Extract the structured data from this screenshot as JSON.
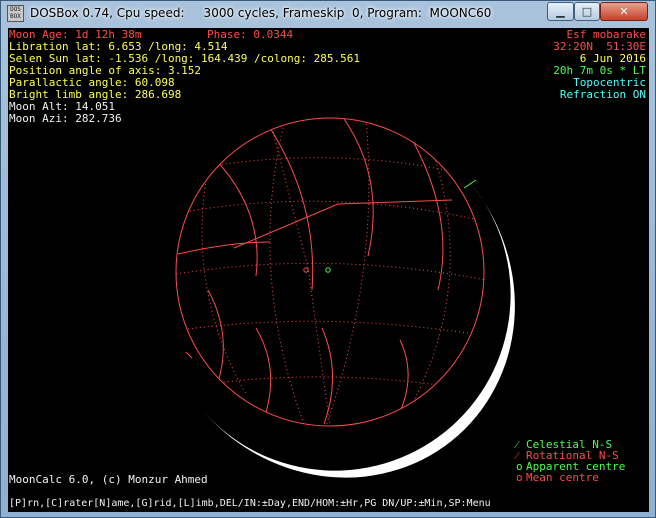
{
  "window": {
    "icon_top": "DOS",
    "icon_bottom": "BOX",
    "title": "DOSBox 0.74, Cpu speed:     3000 cycles, Frameskip  0, Program:  MOONC60",
    "minimize_glyph": "▁",
    "maximize_glyph": "□",
    "close_glyph": "✕"
  },
  "info_left": {
    "moon_age": "Moon Age: 1d 12h 38m",
    "phase": "Phase: 0.0344",
    "libration": "Libration lat: 6.653 /long: 4.514",
    "selen_sun": "Selen Sun lat: -1.536 /long: 164.439 /colong: 285.561",
    "position_angle": "Position angle of axis: 3.152",
    "parallactic_angle": "Parallactic angle: 60.098",
    "bright_limb_angle": "Bright limb angle: 286.698",
    "moon_alt": "Moon Alt: 14.051",
    "moon_azi": "Moon Azi: 282.736"
  },
  "info_right": {
    "location": "Esf mobarake",
    "coordinates": "32:20N  51:30E",
    "date": "6 Jun 2016",
    "time": "20h 7m 0s * LT",
    "mode": "Topocentric",
    "refraction": "Refraction ON"
  },
  "legend": {
    "celestial_mark": "⁄",
    "celestial": "Celestial N-S",
    "rotational_mark": "⁄",
    "rotational": "Rotational N-S",
    "apparent_mark": "o",
    "apparent": "Apparent centre",
    "mean_mark": "o",
    "mean": "Mean centre"
  },
  "footer": {
    "credit": "MoonCalc 6.0, (c) Monzur Ahmed",
    "keys": "[P]rn,[C]rater[N]ame,[G]rid,[L]imb,DEL/IN:±Day,END/HOM:±Hr,PG DN/UP:±Min,SP:Menu"
  },
  "colors": {
    "background": "#000000",
    "red": "#ff4a4a",
    "yellow": "#ffff4a",
    "white": "#f2f2f2",
    "green": "#4aff4a",
    "cyan": "#4affff"
  }
}
